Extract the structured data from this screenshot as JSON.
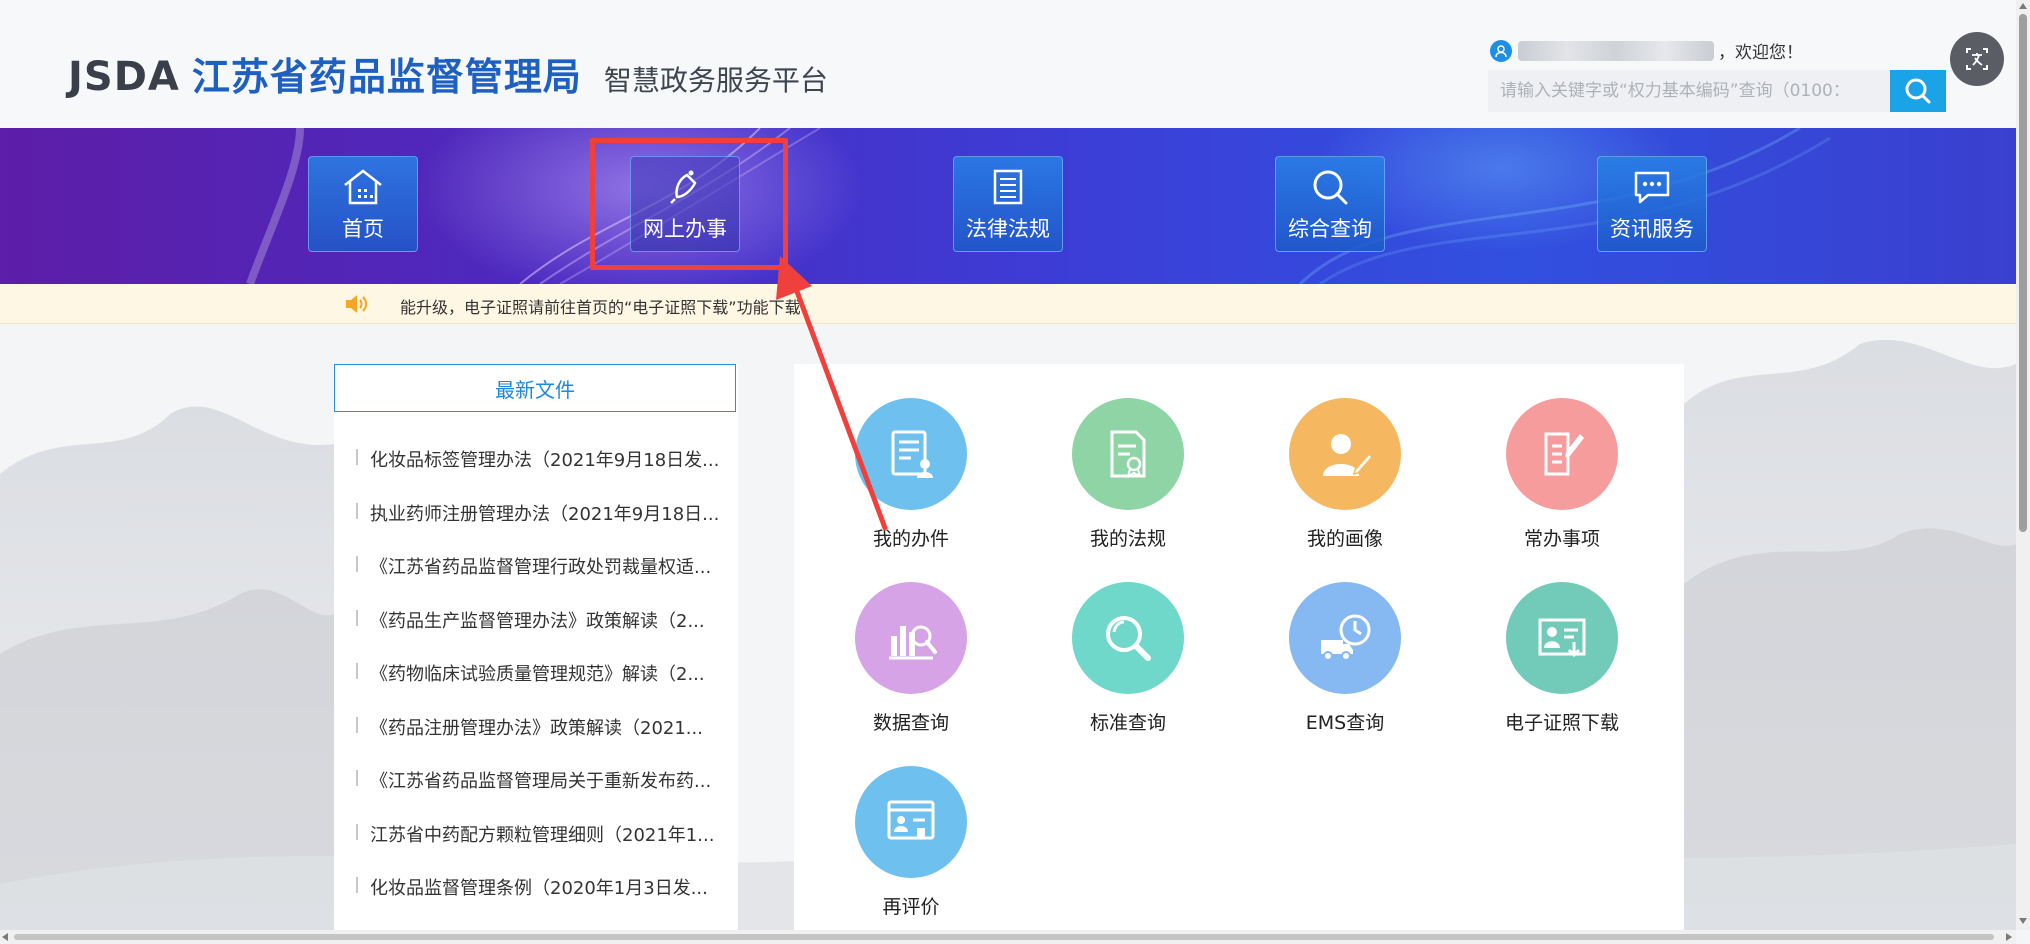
{
  "header": {
    "logo_en": "JSDA",
    "logo_cn": "江苏省药品监督管理局",
    "platform": "智慧政务服务平台",
    "welcome_suffix": "，欢迎您！",
    "search_placeholder": "请输入关键字或“权力基本编码”查询（0100："
  },
  "nav": {
    "items": [
      {
        "label": "首页",
        "icon": "home-icon"
      },
      {
        "label": "网上办事",
        "icon": "hand-bell-icon"
      },
      {
        "label": "法律法规",
        "icon": "document-list-icon"
      },
      {
        "label": "综合查询",
        "icon": "magnifier-icon"
      },
      {
        "label": "资讯服务",
        "icon": "chat-bubble-icon"
      }
    ],
    "active": "网上办事"
  },
  "notice": {
    "text": "能升级，电子证照请前往首页的“电子证照下载”功能下载"
  },
  "files": {
    "title": "最新文件",
    "items": [
      "化妆品标签管理办法（2021年9月18日发...",
      "执业药师注册管理办法（2021年9月18日...",
      "《江苏省药品监督管理行政处罚裁量权适...",
      "《药品生产监督管理办法》政策解读（2...",
      "《药物临床试验质量管理规范》解读（2...",
      "《药品注册管理办法》政策解读（2021...",
      "《江苏省药品监督管理局关于重新发布药...",
      "江苏省中药配方颗粒管理细则（2021年1...",
      "化妆品监督管理条例（2020年1月3日发..."
    ]
  },
  "services": [
    {
      "label": "我的办件",
      "color": "#6ec0ef",
      "icon": "case-file-icon"
    },
    {
      "label": "我的法规",
      "color": "#8fd4a4",
      "icon": "regulation-icon"
    },
    {
      "label": "我的画像",
      "color": "#f5b860",
      "icon": "profile-pen-icon"
    },
    {
      "label": "常办事项",
      "color": "#f79c9c",
      "icon": "frequent-item-icon"
    },
    {
      "label": "数据查询",
      "color": "#d6a4e6",
      "icon": "data-search-icon"
    },
    {
      "label": "标准查询",
      "color": "#6fd8cb",
      "icon": "standard-search-icon"
    },
    {
      "label": "EMS查询",
      "color": "#86b8f2",
      "icon": "ems-truck-icon"
    },
    {
      "label": "电子证照下载",
      "color": "#71cbb8",
      "icon": "certificate-download-icon"
    },
    {
      "label": "再评价",
      "color": "#6ec0ef",
      "icon": "reevaluate-icon"
    }
  ]
}
